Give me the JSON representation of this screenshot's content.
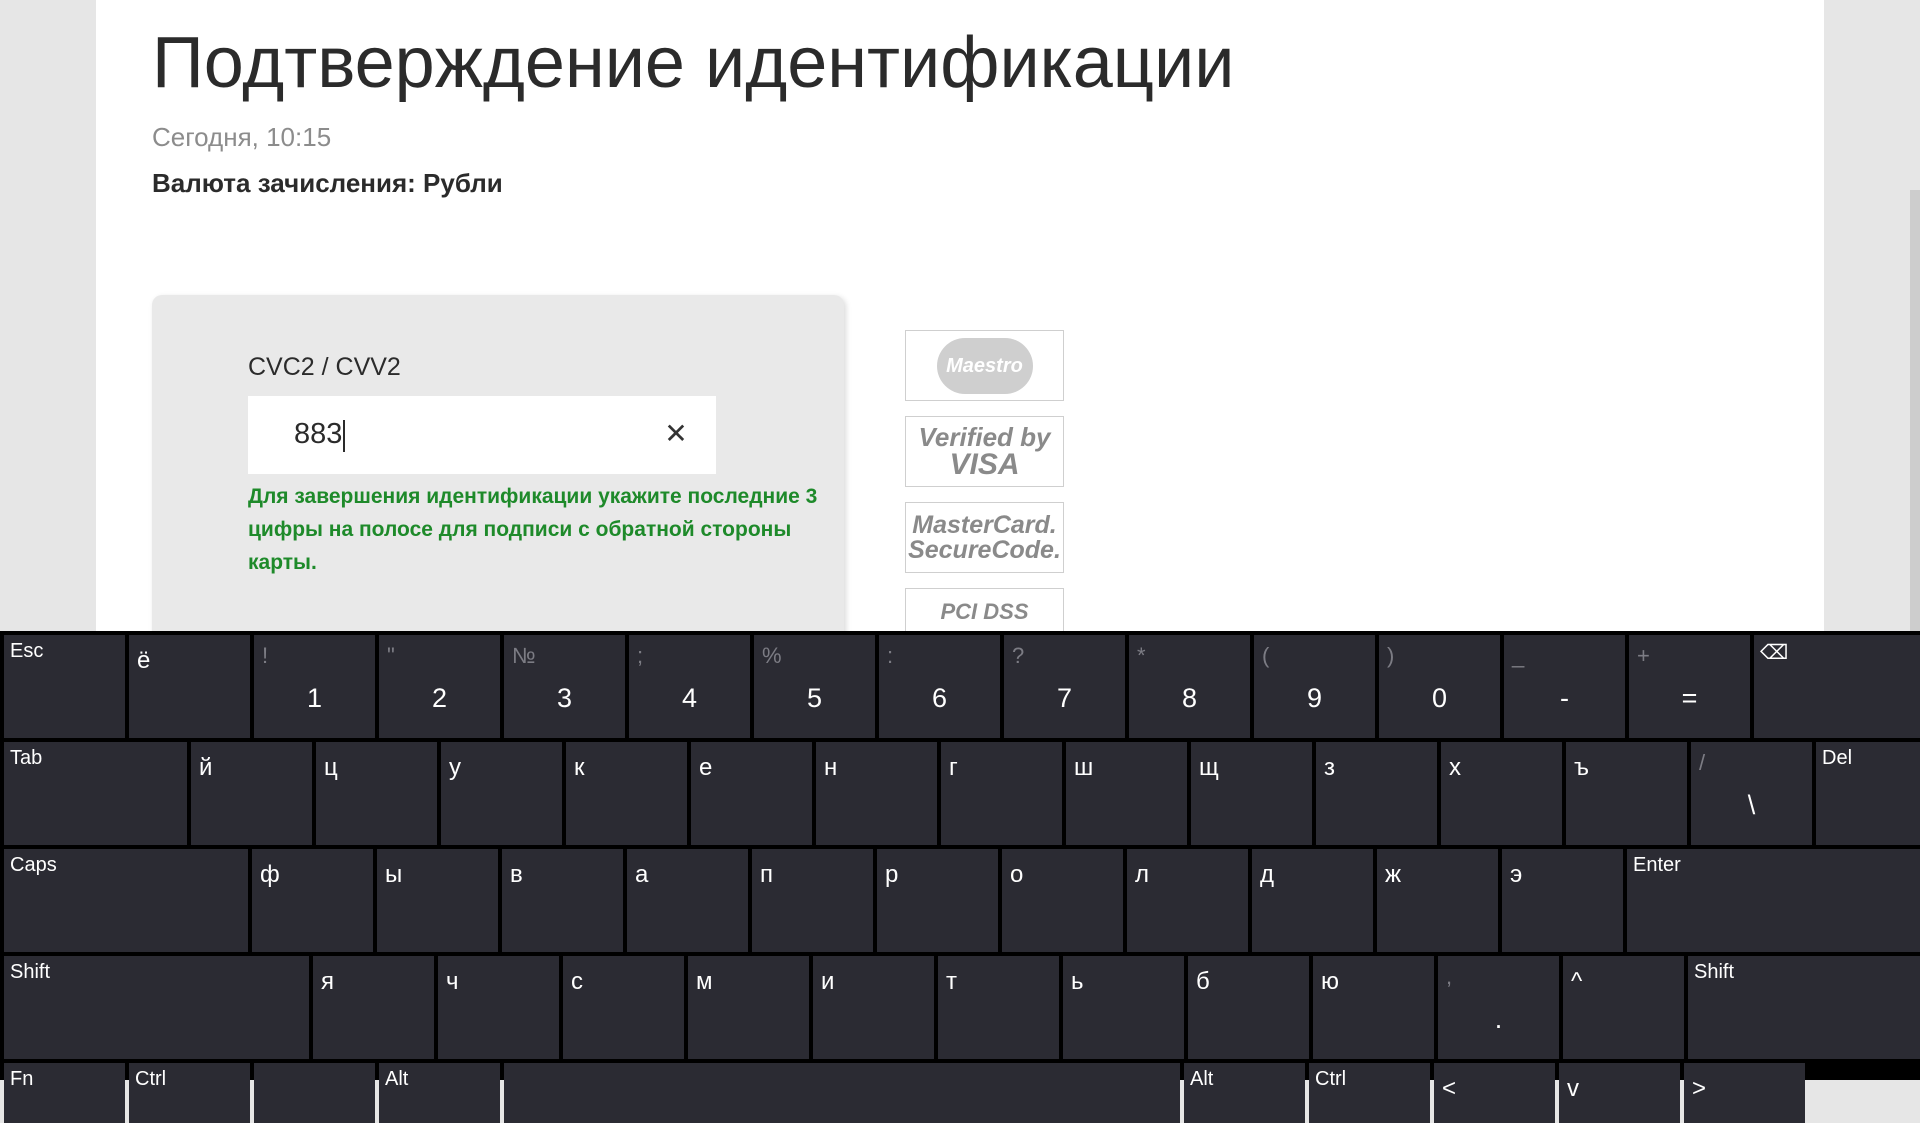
{
  "page": {
    "title": "Подтверждение идентификации",
    "date": "Сегодня, 10:15",
    "currency": "Валюта зачисления: Рубли"
  },
  "form": {
    "cvc_label": "CVC2 / CVV2",
    "cvc_value": "883",
    "clear_symbol": "✕",
    "hint": "Для завершения идентификации укажите последние 3 цифры на полосе для подписи с обратной стороны карты."
  },
  "logos": {
    "maestro": "Maestro",
    "verified_line1": "Verified by",
    "verified_line2": "VISA",
    "mc_line1": "MasterCard.",
    "mc_line2": "SecureCode.",
    "pci": "PCI DSS"
  },
  "keyboard": {
    "row1": [
      {
        "label": "Esc",
        "type": "func"
      },
      {
        "label": "ё",
        "type": "letter"
      },
      {
        "main": "1",
        "sec": "!",
        "type": "num"
      },
      {
        "main": "2",
        "sec": "\"",
        "type": "num"
      },
      {
        "main": "3",
        "sec": "№",
        "type": "num"
      },
      {
        "main": "4",
        "sec": ";",
        "type": "num"
      },
      {
        "main": "5",
        "sec": "%",
        "type": "num"
      },
      {
        "main": "6",
        "sec": ":",
        "type": "num"
      },
      {
        "main": "7",
        "sec": "?",
        "type": "num"
      },
      {
        "main": "8",
        "sec": "*",
        "type": "num"
      },
      {
        "main": "9",
        "sec": "(",
        "type": "num"
      },
      {
        "main": "0",
        "sec": ")",
        "type": "num"
      },
      {
        "main": "-",
        "sec": "_",
        "type": "num"
      },
      {
        "main": "=",
        "sec": "+",
        "type": "num"
      },
      {
        "label": "⌫",
        "type": "func"
      }
    ],
    "row2": [
      {
        "label": "Tab",
        "type": "func"
      },
      {
        "label": "й",
        "type": "letter"
      },
      {
        "label": "ц",
        "type": "letter"
      },
      {
        "label": "у",
        "type": "letter"
      },
      {
        "label": "к",
        "type": "letter"
      },
      {
        "label": "е",
        "type": "letter"
      },
      {
        "label": "н",
        "type": "letter"
      },
      {
        "label": "г",
        "type": "letter"
      },
      {
        "label": "ш",
        "type": "letter"
      },
      {
        "label": "щ",
        "type": "letter"
      },
      {
        "label": "з",
        "type": "letter"
      },
      {
        "label": "х",
        "type": "letter"
      },
      {
        "label": "ъ",
        "type": "letter"
      },
      {
        "main": "\\",
        "sec": "/",
        "type": "num"
      },
      {
        "label": "Del",
        "type": "func"
      }
    ],
    "row3": [
      {
        "label": "Caps",
        "type": "func"
      },
      {
        "label": "ф",
        "type": "letter"
      },
      {
        "label": "ы",
        "type": "letter"
      },
      {
        "label": "в",
        "type": "letter"
      },
      {
        "label": "а",
        "type": "letter"
      },
      {
        "label": "п",
        "type": "letter"
      },
      {
        "label": "р",
        "type": "letter"
      },
      {
        "label": "о",
        "type": "letter"
      },
      {
        "label": "л",
        "type": "letter"
      },
      {
        "label": "д",
        "type": "letter"
      },
      {
        "label": "ж",
        "type": "letter"
      },
      {
        "label": "э",
        "type": "letter"
      },
      {
        "label": "Enter",
        "type": "func"
      }
    ],
    "row4": [
      {
        "label": "Shift",
        "type": "func"
      },
      {
        "label": "я",
        "type": "letter"
      },
      {
        "label": "ч",
        "type": "letter"
      },
      {
        "label": "с",
        "type": "letter"
      },
      {
        "label": "м",
        "type": "letter"
      },
      {
        "label": "и",
        "type": "letter"
      },
      {
        "label": "т",
        "type": "letter"
      },
      {
        "label": "ь",
        "type": "letter"
      },
      {
        "label": "б",
        "type": "letter"
      },
      {
        "label": "ю",
        "type": "letter"
      },
      {
        "main": ".",
        "sec": ",",
        "type": "num"
      },
      {
        "label": "^",
        "type": "letter"
      },
      {
        "label": "Shift",
        "type": "func"
      }
    ],
    "row5": [
      {
        "label": "Fn",
        "type": "func"
      },
      {
        "label": "Ctrl",
        "type": "func"
      },
      {
        "label": "",
        "type": "func"
      },
      {
        "label": "Alt",
        "type": "func"
      },
      {
        "label": "",
        "type": "func"
      },
      {
        "label": "Alt",
        "type": "func"
      },
      {
        "label": "Ctrl",
        "type": "func"
      },
      {
        "label": "<",
        "type": "letter"
      },
      {
        "label": "v",
        "type": "letter"
      },
      {
        "label": ">",
        "type": "letter"
      }
    ]
  }
}
